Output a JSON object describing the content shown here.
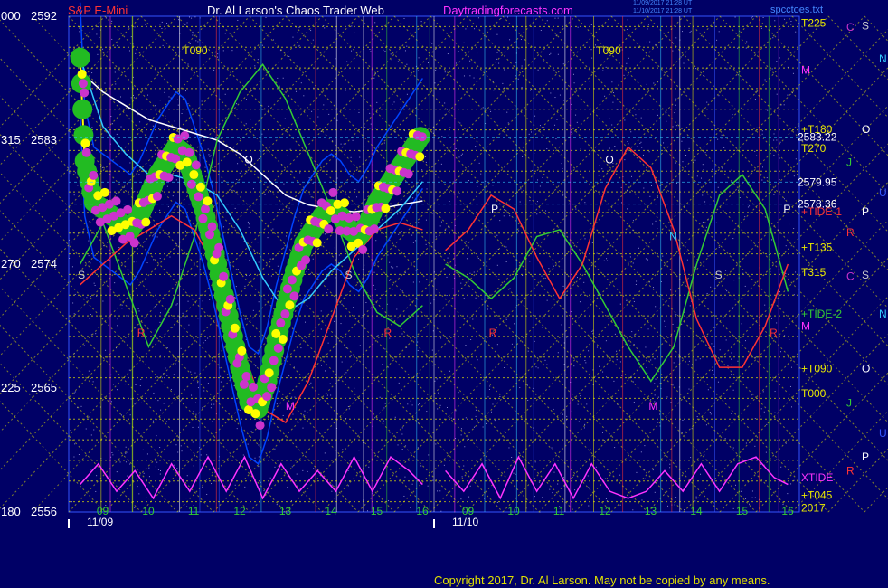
{
  "header": {
    "instrument": "S&P E-Mini",
    "site": "Dr. Al Larson's Chaos Trader Web",
    "url": "Daytradingforecasts.com",
    "stamp1": "11/09/2017 21:28 UT",
    "stamp2": "11/10/2017 21:28 UT",
    "file": "spcctoes.txt"
  },
  "copyright": "Copyright 2017, Dr. Al Larson. May not be copied by any means.",
  "colors": {
    "background": "#000066",
    "grid_yellow": "#e8e800",
    "price_axis": "#ffffff",
    "accent_magenta": "#ff33ff",
    "accent_red": "#ff3333",
    "accent_green": "#33cc33",
    "accent_cyan": "#33ccff",
    "white_avg": "#ffffff",
    "blue_band": "#0044ff"
  },
  "chart_data": {
    "type": "line",
    "ylim": [
      2556,
      2592
    ],
    "left_axis": [
      {
        "angle": "000",
        "price": "2592",
        "value": 2592
      },
      {
        "angle": "315",
        "price": "2583",
        "value": 2583
      },
      {
        "angle": "270",
        "price": "2574",
        "value": 2574
      },
      {
        "angle": "225",
        "price": "2565",
        "value": 2565
      },
      {
        "angle": "180",
        "price": "2556",
        "value": 2556
      }
    ],
    "x_ticks_day1": [
      "09",
      "10",
      "11",
      "12",
      "13",
      "14",
      "15",
      "16"
    ],
    "x_ticks_day2": [
      "09",
      "10",
      "11",
      "12",
      "13",
      "14",
      "15",
      "16"
    ],
    "date_labels": [
      "11/09",
      "11/10"
    ],
    "price_markers": [
      {
        "label": "2583.22",
        "value": 2583.22
      },
      {
        "label": "2579.95",
        "value": 2579.95
      },
      {
        "label": "2578.36",
        "value": 2578.36
      }
    ],
    "right_labels": [
      {
        "text": "T225",
        "value": 2591.5
      },
      {
        "text": "M",
        "value": 2588.1
      },
      {
        "text": "+T180",
        "value": 2583.8
      },
      {
        "text": "T270",
        "value": 2582.4
      },
      {
        "text": "+TIDE-1",
        "value": 2577.8
      },
      {
        "text": "+T135",
        "value": 2575.2
      },
      {
        "text": "T315",
        "value": 2573.4
      },
      {
        "text": "+TIDE-2",
        "value": 2570.4
      },
      {
        "text": "M",
        "value": 2569.5
      },
      {
        "text": "+T090",
        "value": 2566.4
      },
      {
        "text": "T000",
        "value": 2564.6
      },
      {
        "text": "XTIDE",
        "value": 2558.5
      },
      {
        "text": "+T045",
        "value": 2557.2
      },
      {
        "text": "2017",
        "value": 2556.3
      }
    ],
    "planet_letters": [
      {
        "text": "C",
        "value": 2591.2,
        "col": 1,
        "color": "#cc33cc"
      },
      {
        "text": "S",
        "value": 2591.3,
        "col": 2,
        "color": "#cccccc"
      },
      {
        "text": "N",
        "value": 2588.9,
        "col": 3,
        "color": "#33ccff"
      },
      {
        "text": "O",
        "value": 2583.8,
        "col": 2,
        "color": "#ffffff"
      },
      {
        "text": "J",
        "value": 2581.4,
        "col": 1,
        "color": "#33cc33"
      },
      {
        "text": "U",
        "value": 2579.2,
        "col": 3,
        "color": "#3355ff"
      },
      {
        "text": "P",
        "value": 2577.8,
        "col": 2,
        "color": "#ffffff"
      },
      {
        "text": "R",
        "value": 2576.3,
        "col": 1,
        "color": "#ff3333"
      },
      {
        "text": "C",
        "value": 2573.1,
        "col": 1,
        "color": "#cc33cc"
      },
      {
        "text": "S",
        "value": 2573.2,
        "col": 2,
        "color": "#cccccc"
      },
      {
        "text": "N",
        "value": 2570.4,
        "col": 3,
        "color": "#33ccff"
      },
      {
        "text": "O",
        "value": 2566.4,
        "col": 2,
        "color": "#ffffff"
      },
      {
        "text": "J",
        "value": 2563.9,
        "col": 1,
        "color": "#33cc33"
      },
      {
        "text": "U",
        "value": 2561.7,
        "col": 3,
        "color": "#3355ff"
      },
      {
        "text": "P",
        "value": 2560.0,
        "col": 2,
        "color": "#ffffff"
      },
      {
        "text": "R",
        "value": 2559.0,
        "col": 1,
        "color": "#ff3333"
      }
    ],
    "in_chart_labels": [
      {
        "text": "T090",
        "value": 2589.5,
        "day": 1,
        "hour": 10.75,
        "color": "#e8e800"
      },
      {
        "text": "T090",
        "value": 2589.5,
        "day": 2,
        "hour": 11.8,
        "color": "#e8e800"
      },
      {
        "text": "O",
        "value": 2581.6,
        "day": 1,
        "hour": 12.1,
        "color": "#ffffff"
      },
      {
        "text": "O",
        "value": 2581.6,
        "day": 2,
        "hour": 12.0,
        "color": "#ffffff"
      },
      {
        "text": "P",
        "value": 2578.0,
        "day": 2,
        "hour": 9.5,
        "color": "#ffffff"
      },
      {
        "text": "P",
        "value": 2578.0,
        "day": 2,
        "hour": 15.9,
        "color": "#ffffff"
      },
      {
        "text": "N",
        "value": 2576.0,
        "day": 2,
        "hour": 13.4,
        "color": "#33ccff"
      },
      {
        "text": "S",
        "value": 2573.2,
        "day": 1,
        "hour": 8.45,
        "color": "#cccccc"
      },
      {
        "text": "S",
        "value": 2573.2,
        "day": 1,
        "hour": 14.3,
        "color": "#cccccc"
      },
      {
        "text": "S",
        "value": 2573.2,
        "day": 2,
        "hour": 14.4,
        "color": "#cccccc"
      },
      {
        "text": "R",
        "value": 2569.0,
        "day": 1,
        "hour": 9.75,
        "color": "#ff3333"
      },
      {
        "text": "R",
        "value": 2569.0,
        "day": 1,
        "hour": 15.15,
        "color": "#ff3333"
      },
      {
        "text": "R",
        "value": 2569.0,
        "day": 2,
        "hour": 9.45,
        "color": "#ff3333"
      },
      {
        "text": "R",
        "value": 2569.0,
        "day": 2,
        "hour": 15.6,
        "color": "#ff3333"
      },
      {
        "text": "M",
        "value": 2563.7,
        "day": 1,
        "hour": 13.0,
        "color": "#ff33ff"
      },
      {
        "text": "M",
        "value": 2563.7,
        "day": 2,
        "hour": 12.95,
        "color": "#ff33ff"
      }
    ],
    "series": [
      {
        "name": "",
        "color": "#ffff00",
        "day": 1,
        "x": [
          8.5,
          8.6,
          8.8,
          9.0,
          9.2,
          9.4,
          9.6,
          9.8,
          10.0,
          10.2,
          10.4,
          10.6,
          10.8,
          11.0,
          11.2,
          11.4,
          11.6,
          11.8,
          12.0,
          12.2,
          12.4,
          12.6,
          12.8,
          13.0,
          13.2,
          13.4,
          13.6,
          13.8,
          14.0,
          14.2,
          14.4,
          14.6,
          14.8,
          15.0,
          15.2,
          15.4,
          15.6,
          15.8,
          16.0
        ],
        "y": [
          2589.0,
          2581.5,
          2578.5,
          2578.0,
          2577.5,
          2577.0,
          2576.5,
          2577.5,
          2579.0,
          2580.5,
          2581.5,
          2582.5,
          2582.0,
          2580.0,
          2578.0,
          2575.5,
          2572.5,
          2569.5,
          2566.5,
          2564.0,
          2563.5,
          2565.5,
          2568.5,
          2571.0,
          2573.5,
          2575.5,
          2576.5,
          2577.5,
          2578.0,
          2577.5,
          2576.5,
          2576.0,
          2577.0,
          2578.5,
          2579.5,
          2580.5,
          2581.5,
          2582.5,
          2583.5
        ]
      },
      {
        "name": "",
        "color": "#ffffff",
        "day": 1,
        "x": [
          8.5,
          9.0,
          9.5,
          10.0,
          10.5,
          11.0,
          11.5,
          12.0,
          12.5,
          13.0,
          13.5,
          14.0,
          14.5,
          15.0,
          15.5,
          16.0
        ],
        "y": [
          2588.0,
          2586.5,
          2585.5,
          2584.5,
          2584.0,
          2583.5,
          2583.0,
          2582.0,
          2580.5,
          2579.0,
          2578.3,
          2578.0,
          2577.8,
          2578.0,
          2578.3,
          2578.6
        ]
      },
      {
        "name": "",
        "color": "#33ccff",
        "day": 1,
        "x": [
          8.5,
          9.0,
          9.5,
          10.0,
          10.5,
          11.0,
          11.5,
          12.0,
          12.5,
          13.0,
          13.5,
          14.0,
          14.5,
          15.0,
          15.5,
          16.0
        ],
        "y": [
          2589.0,
          2584.0,
          2582.0,
          2580.5,
          2580.5,
          2580.0,
          2579.0,
          2576.5,
          2573.0,
          2570.5,
          2571.5,
          2573.5,
          2575.0,
          2576.5,
          2578.0,
          2580.0
        ]
      },
      {
        "name": "",
        "color": "#ff33ff",
        "day": 1,
        "x": [
          8.5,
          8.9,
          9.3,
          9.7,
          10.1,
          10.5,
          10.9,
          11.3,
          11.7,
          12.1,
          12.5,
          12.9,
          13.3,
          13.7,
          14.1,
          14.5,
          14.9,
          15.3,
          15.7,
          16.0
        ],
        "y": [
          2558.0,
          2559.5,
          2557.5,
          2559.0,
          2557.0,
          2559.5,
          2557.5,
          2560.0,
          2557.5,
          2560.0,
          2557.0,
          2559.5,
          2557.5,
          2559.0,
          2557.5,
          2560.0,
          2557.5,
          2560.0,
          2559.0,
          2558.0
        ]
      },
      {
        "name": "",
        "color": "#ff33ff",
        "day": 2,
        "x": [
          8.5,
          8.9,
          9.3,
          9.7,
          10.1,
          10.5,
          10.9,
          11.3,
          11.7,
          12.1,
          12.5,
          12.9,
          13.3,
          13.7,
          14.1,
          14.5,
          14.9,
          15.3,
          15.7,
          16.0
        ],
        "y": [
          2559.0,
          2557.5,
          2559.5,
          2557.0,
          2560.0,
          2557.5,
          2559.5,
          2557.0,
          2559.5,
          2557.5,
          2557.0,
          2557.5,
          2559.0,
          2557.5,
          2559.5,
          2557.5,
          2559.5,
          2560.0,
          2558.5,
          2558.0
        ]
      },
      {
        "name": "",
        "color": "#33cc33",
        "day": 1,
        "x": [
          8.5,
          9.0,
          9.5,
          10.0,
          10.5,
          11.0,
          11.5,
          12.0,
          12.5,
          13.0,
          13.5,
          14.0,
          14.5,
          15.0,
          15.5,
          16.0
        ],
        "y": [
          2574.0,
          2577.0,
          2572.5,
          2568.0,
          2571.0,
          2576.0,
          2583.0,
          2586.5,
          2588.5,
          2586.0,
          2582.0,
          2578.0,
          2573.5,
          2570.5,
          2569.5,
          2571.0
        ]
      },
      {
        "name": "",
        "color": "#33cc33",
        "day": 2,
        "x": [
          8.5,
          9.0,
          9.5,
          10.0,
          10.5,
          11.0,
          11.5,
          12.0,
          12.5,
          13.0,
          13.5,
          14.0,
          14.5,
          15.0,
          15.5,
          16.0
        ],
        "y": [
          2574.0,
          2573.0,
          2571.5,
          2573.0,
          2576.0,
          2576.5,
          2574.0,
          2571.0,
          2568.0,
          2565.5,
          2568.0,
          2574.0,
          2579.0,
          2580.5,
          2578.0,
          2572.0
        ]
      },
      {
        "name": "",
        "color": "#ff3333",
        "day": 1,
        "x": [
          8.5,
          9.0,
          9.5,
          10.0,
          10.5,
          11.0,
          11.5,
          12.0,
          12.5,
          13.0,
          13.5,
          14.0,
          14.5,
          15.0,
          15.5,
          16.0
        ],
        "y": [
          2572.5,
          2574.0,
          2575.5,
          2576.5,
          2577.5,
          2576.5,
          2573.5,
          2568.5,
          2563.5,
          2562.5,
          2565.5,
          2570.0,
          2574.5,
          2576.5,
          2577.0,
          2576.5
        ]
      },
      {
        "name": "",
        "color": "#ff3333",
        "day": 2,
        "x": [
          8.5,
          9.0,
          9.5,
          10.0,
          10.5,
          11.0,
          11.5,
          12.0,
          12.5,
          13.0,
          13.5,
          14.0,
          14.5,
          15.0,
          15.5,
          16.0
        ],
        "y": [
          2575.0,
          2576.5,
          2579.0,
          2578.0,
          2574.5,
          2571.5,
          2574.0,
          2579.5,
          2582.5,
          2581.0,
          2576.5,
          2570.0,
          2566.5,
          2566.5,
          2569.5,
          2574.0
        ]
      }
    ]
  }
}
